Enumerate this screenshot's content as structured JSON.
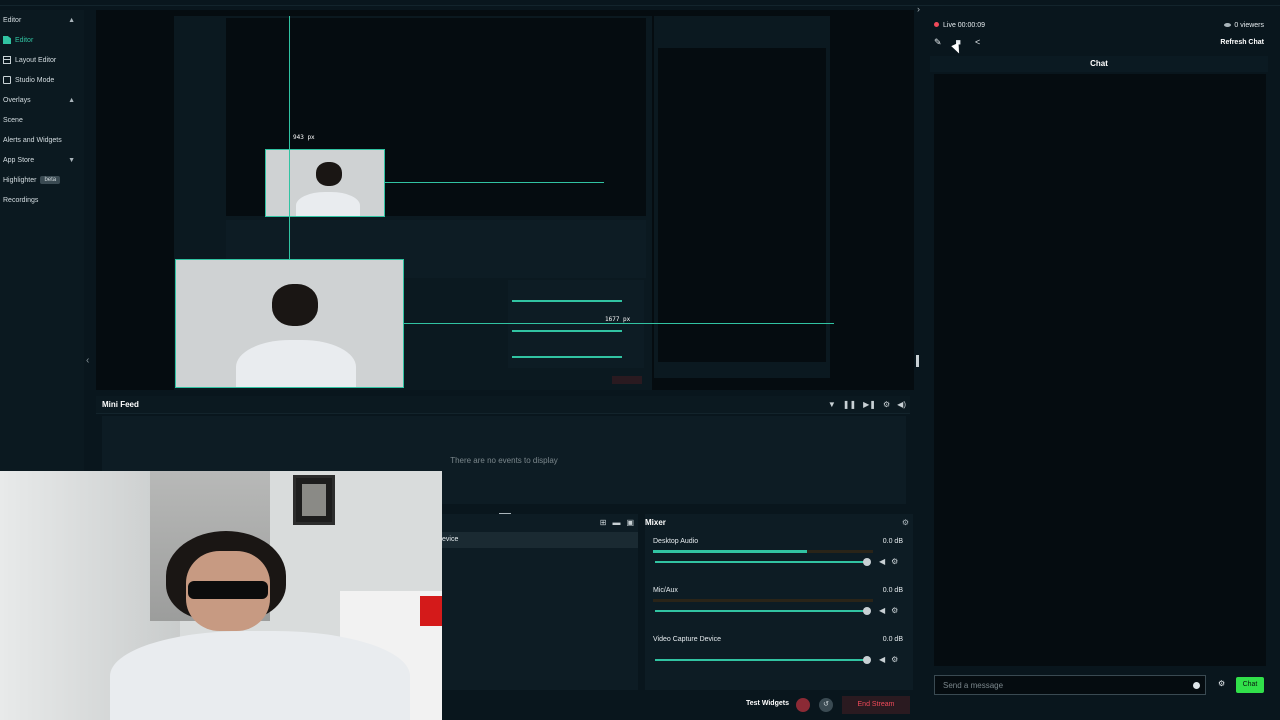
{
  "nav": {
    "items": [
      {
        "label": "Editor",
        "type": "section",
        "chevron": "▲"
      },
      {
        "label": "Editor",
        "type": "item",
        "active": true,
        "icon": "editor-icon"
      },
      {
        "label": "Layout Editor",
        "type": "item",
        "icon": "layout-icon"
      },
      {
        "label": "Studio Mode",
        "type": "item",
        "icon": "studio-icon"
      },
      {
        "label": "Overlays",
        "type": "section",
        "chevron": "▲"
      },
      {
        "label": "Scene",
        "type": "item"
      },
      {
        "label": "Alerts and Widgets",
        "type": "item"
      },
      {
        "label": "App Store",
        "type": "section",
        "chevron": "▼"
      },
      {
        "label": "Highlighter",
        "type": "item",
        "badge": "beta"
      },
      {
        "label": "Recordings",
        "type": "item"
      }
    ]
  },
  "preview": {
    "width_px_label": "943 px",
    "height_px_label": "1677 px"
  },
  "mini_feed": {
    "title": "Mini Feed",
    "empty_text": "There are no events to display",
    "tools": [
      "filter-icon",
      "pause-icon",
      "skip-icon",
      "settings-icon",
      "mute-icon"
    ]
  },
  "sources": {
    "row_label": "evice"
  },
  "mixer": {
    "title": "Mixer",
    "channels": [
      {
        "name": "Desktop Audio",
        "db": "0.0 dB",
        "level": 0.7
      },
      {
        "name": "Mic/Aux",
        "db": "0.0 dB",
        "level": 0.0
      },
      {
        "name": "Video Capture Device",
        "db": "0.0 dB",
        "level": 0.0
      }
    ]
  },
  "bottombar": {
    "test_widgets": "Test Widgets",
    "end_stream": "End Stream"
  },
  "chat": {
    "live_label": "Live 00:00:09",
    "viewers": "0 viewers",
    "refresh_label": "Refresh Chat",
    "title": "Chat",
    "input_placeholder": "Send a message",
    "send_label": "Chat"
  },
  "colors": {
    "accent": "#31c3a2",
    "live_red": "#f04a5a",
    "send_green": "#31e04a",
    "background": "#09161d"
  }
}
